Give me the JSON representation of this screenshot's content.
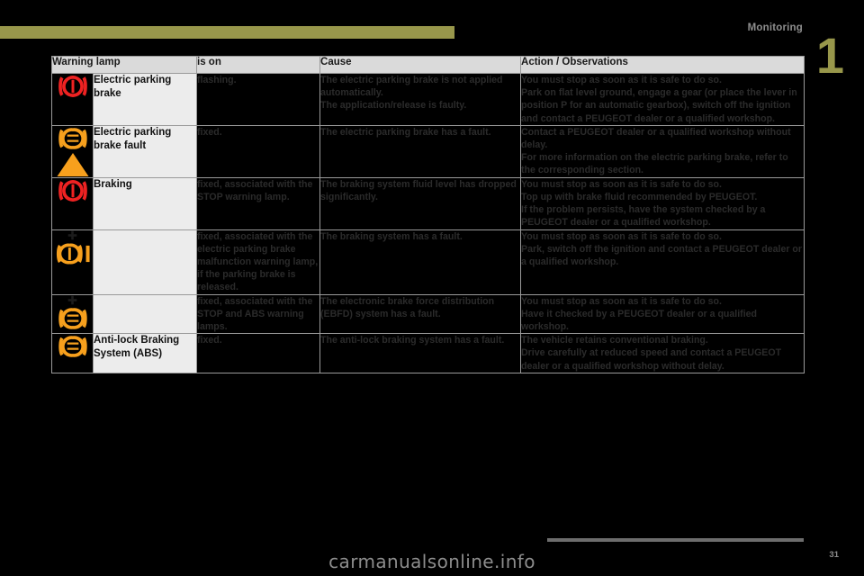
{
  "page": {
    "chapter_label": "Monitoring",
    "chapter_number": "1",
    "page_number": "31",
    "watermark": "carmanualsonline.info",
    "accent_color": "#98974b",
    "header_bg": "#dadada",
    "cell_bg": "#000000",
    "label_bg": "#ececec"
  },
  "table": {
    "headers": [
      {
        "id": "warning-lamp",
        "label": "Warning lamp"
      },
      {
        "id": "is-on",
        "label": "is on"
      },
      {
        "id": "cause",
        "label": "Cause"
      },
      {
        "id": "action",
        "label": "Action / Observations"
      }
    ],
    "rows": [
      {
        "icon": "brake-warning-red-icon",
        "icon_color": "#ee2222",
        "name": "Electric parking brake",
        "is_on": "flashing.",
        "cause": [
          "The electric parking brake is not applied automatically.",
          "The application/release is faulty."
        ],
        "action": [
          "You must stop as soon as it is safe to do so.",
          "Park on flat level ground, engage a gear (or place the lever in position P for an automatic gearbox), switch off the ignition and contact a PEUGEOT dealer or a qualified workshop."
        ]
      },
      {
        "icon": "brake-fault-amber-triangle-icon",
        "icon_color": "#f7a01d",
        "name": "Electric parking brake fault",
        "is_on": "fixed.",
        "cause": [
          "The electric parking brake has a fault."
        ],
        "action": [
          "Contact a PEUGEOT dealer or a qualified workshop without delay.",
          "For more information on the electric parking brake, refer to the corresponding section."
        ]
      },
      {
        "icon": "brake-warning-red-icon",
        "icon_color": "#ee2222",
        "name": "Braking",
        "is_on": "fixed, associated with the STOP warning lamp.",
        "cause": [
          "The braking system fluid level has dropped significantly."
        ],
        "action": [
          "You must stop as soon as it is safe to do so.",
          "Top up with brake fluid recommended by PEUGEOT.",
          "If the problem persists, have the system checked by a PEUGEOT dealer or a qualified workshop."
        ]
      },
      {
        "icon": "parking-brake-release-amber-icon",
        "icon_color": "#f7a01d",
        "name": "",
        "is_on": "fixed, associated with the electric parking brake malfunction warning lamp, if the parking brake is released.",
        "cause": [
          "The braking system has a fault."
        ],
        "action": [
          "You must stop as soon as it is safe to do so.",
          "Park, switch off the ignition and contact a PEUGEOT dealer or a qualified workshop."
        ]
      },
      {
        "icon": "rear-fog-brake-amber-icon",
        "icon_color": "#f7a01d",
        "name": "",
        "is_on": "fixed, associated with the STOP and ABS warning lamps.",
        "cause": [
          "The electronic brake force distribution (EBFD) system has a fault."
        ],
        "action": [
          "You must stop as soon as it is safe to do so.",
          "Have it checked by a PEUGEOT dealer or a qualified workshop."
        ]
      },
      {
        "icon": "abs-amber-icon",
        "icon_color": "#f7a01d",
        "name": "Anti-lock Braking System (ABS)",
        "is_on": "fixed.",
        "cause": [
          "The anti-lock braking system has a fault."
        ],
        "action": [
          "The vehicle retains conventional braking.",
          "Drive carefully at reduced speed and contact a PEUGEOT dealer or a qualified workshop without delay."
        ]
      }
    ]
  }
}
